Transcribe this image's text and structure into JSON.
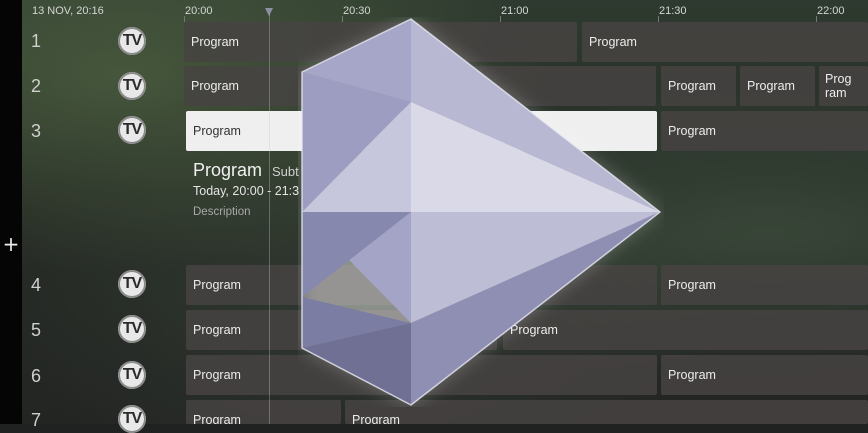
{
  "header": {
    "date": "13 NOV, 20:16",
    "times": [
      "20:00",
      "20:30",
      "21:00",
      "21:30",
      "22:00"
    ]
  },
  "sidebar": {
    "add_icon": "+"
  },
  "channels": [
    {
      "number": "1",
      "logo": "TV",
      "programs": [
        "Program",
        "Program"
      ]
    },
    {
      "number": "2",
      "logo": "TV",
      "programs": [
        "Program",
        "Program",
        "Program",
        "Prog ram"
      ]
    },
    {
      "number": "3",
      "logo": "TV",
      "programs": [
        "Program",
        "Program"
      ]
    },
    {
      "number": "4",
      "logo": "TV",
      "programs": [
        "Program",
        "Program"
      ]
    },
    {
      "number": "5",
      "logo": "TV",
      "programs": [
        "Program",
        "Program"
      ]
    },
    {
      "number": "6",
      "logo": "TV",
      "programs": [
        "Program",
        "Program"
      ]
    },
    {
      "number": "7",
      "logo": "TV",
      "programs": [
        "Program",
        "Program"
      ]
    }
  ],
  "selected_detail": {
    "title": "Program",
    "subtitle": "Subt",
    "time": "Today, 20:00 - 21:3",
    "description": "Description"
  },
  "overlay": {
    "icon": "crystal-play-icon"
  },
  "colors": {
    "selected_cell": "#efefef",
    "cell": "#46423f",
    "crystal": "#9b9cc0"
  }
}
